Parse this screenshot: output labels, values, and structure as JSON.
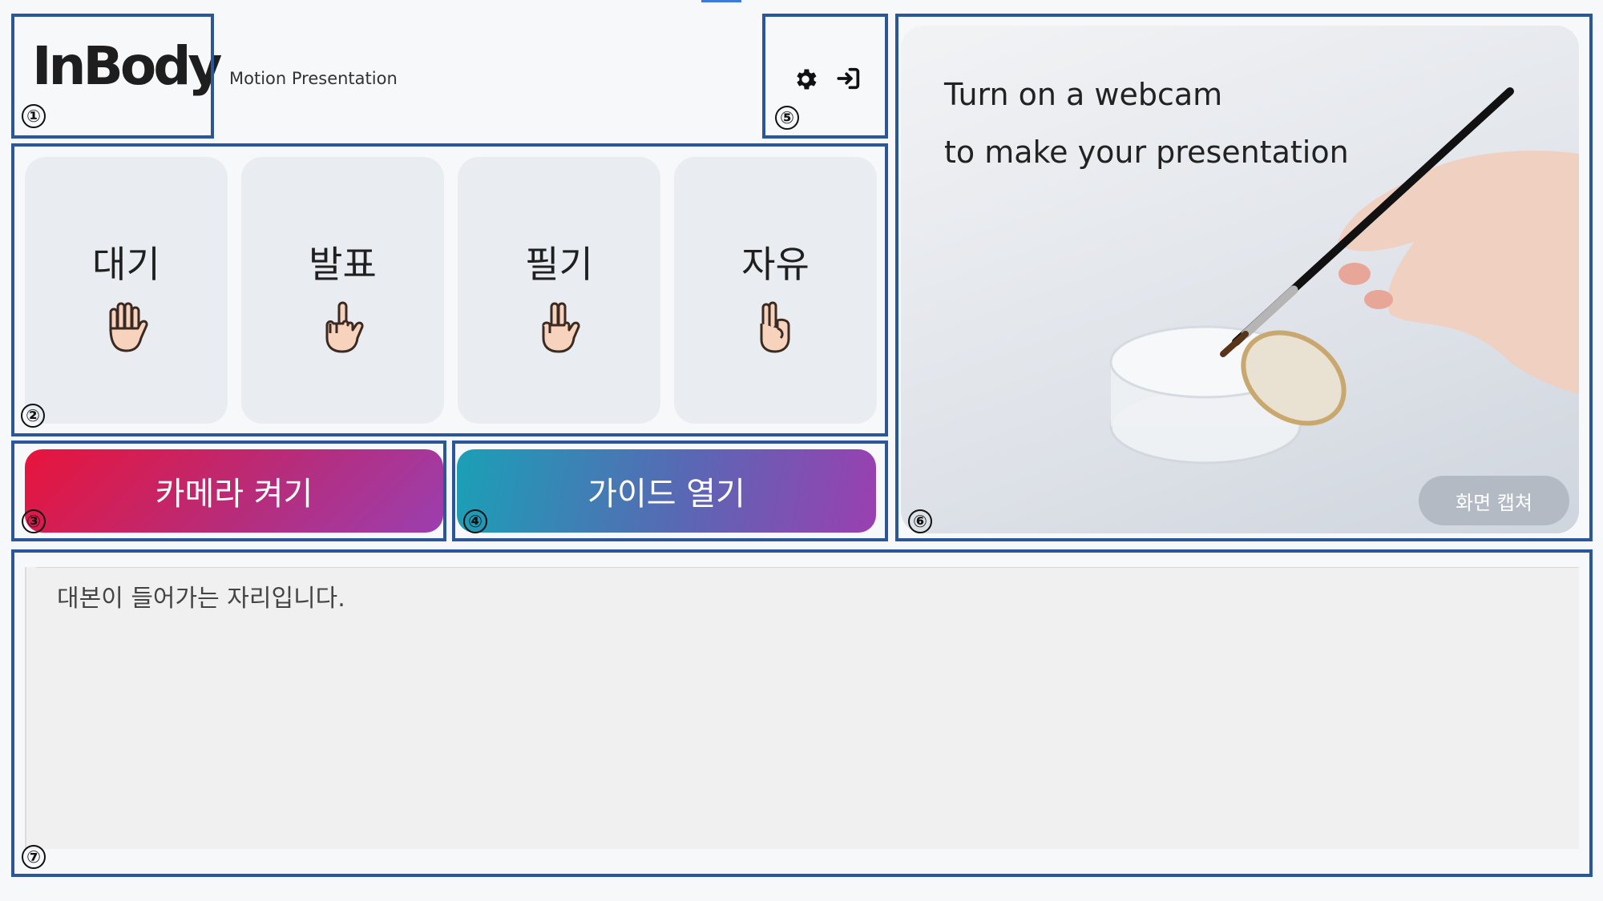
{
  "header": {
    "logo_text": "InBody",
    "subtitle": "Motion Presentation",
    "settings_icon": "gear-icon",
    "exit_icon": "sign-in-icon"
  },
  "modes": [
    {
      "label": "대기",
      "icon": "open-hand-icon"
    },
    {
      "label": "발표",
      "icon": "pointing-finger-icon"
    },
    {
      "label": "필기",
      "icon": "two-finger-hand-icon"
    },
    {
      "label": "자유",
      "icon": "fist-hand-icon"
    }
  ],
  "buttons": {
    "camera_label": "카메라 켜기",
    "guide_label": "가이드 열기"
  },
  "preview": {
    "line1": "Turn on a webcam",
    "line2": "to make your presentation",
    "capture_label": "화면 캡쳐"
  },
  "script": {
    "placeholder": "대본이 들어가는 자리입니다."
  },
  "annotations": [
    "①",
    "②",
    "③",
    "④",
    "⑤",
    "⑥",
    "⑦"
  ],
  "colors": {
    "annotation_border": "#2b579a",
    "camera_gradient_start": "#e8143b",
    "camera_gradient_end": "#9b3fb0",
    "guide_gradient_start": "#1aa0b6",
    "guide_gradient_end": "#9b3fb0",
    "capture_button": "#b3bac4"
  }
}
